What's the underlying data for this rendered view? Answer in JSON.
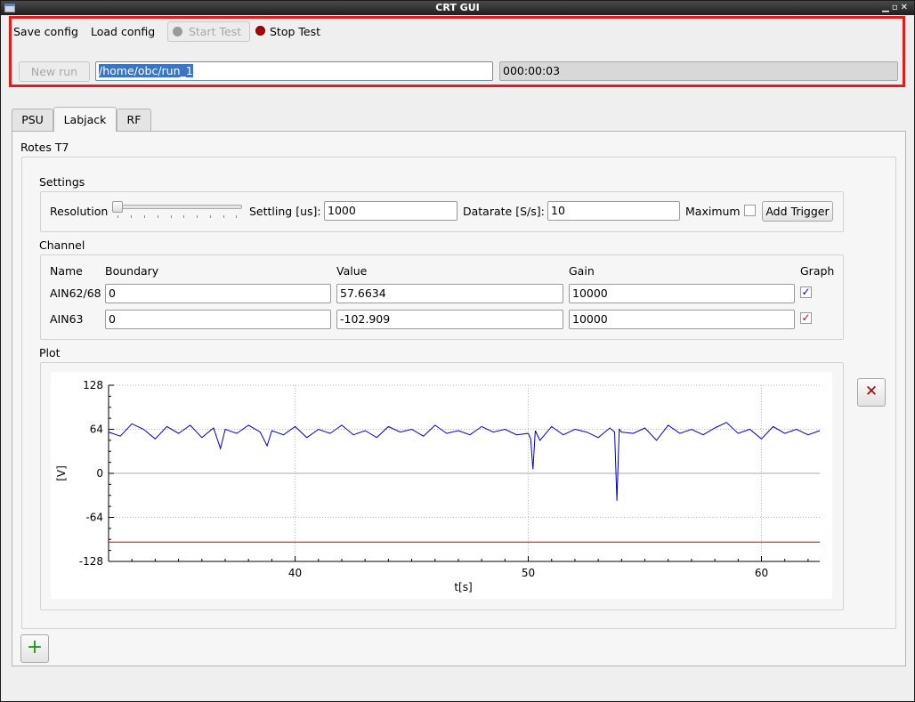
{
  "window": {
    "title": "CRT GUI"
  },
  "toolbar": {
    "save_config": "Save config",
    "load_config": "Load config",
    "start_test": "Start Test",
    "stop_test": "Stop Test",
    "new_run": "New run",
    "run_path": "/home/obc/run_1",
    "elapsed": "000:00:03"
  },
  "tabs": [
    {
      "label": "PSU"
    },
    {
      "label": "Labjack"
    },
    {
      "label": "RF"
    }
  ],
  "device": {
    "name": "Rotes T7"
  },
  "settings": {
    "title": "Settings",
    "resolution_label": "Resolution",
    "settling_label": "Settling [us]:",
    "settling_value": "1000",
    "datarate_label": "Datarate [S/s]:",
    "datarate_value": "10",
    "maximum_label": "Maximum",
    "add_trigger": "Add Trigger"
  },
  "channel": {
    "title": "Channel",
    "headers": {
      "name": "Name",
      "boundary": "Boundary",
      "value": "Value",
      "gain": "Gain",
      "graph": "Graph"
    },
    "rows": [
      {
        "name": "AIN62/68",
        "boundary": "0",
        "value": "57.6634",
        "gain": "10000",
        "graph": true,
        "color": "#0000cc"
      },
      {
        "name": "AIN63",
        "boundary": "0",
        "value": "-102.909",
        "gain": "10000",
        "graph": true,
        "color": "#cc0000"
      }
    ]
  },
  "plot": {
    "title": "Plot"
  },
  "icons": {
    "close": "close-icon",
    "add": "plus-icon"
  },
  "chart_data": {
    "type": "line",
    "xlabel": "t[s]",
    "ylabel": "[V]",
    "xlim": [
      32.0,
      62.5
    ],
    "ylim": [
      -128,
      128
    ],
    "xticks": [
      40,
      50,
      60
    ],
    "yticks": [
      128,
      64,
      0,
      -64,
      -128
    ],
    "grid": true,
    "series": [
      {
        "color": "#0000cc",
        "x": [
          32.0,
          32.5,
          33.0,
          33.5,
          34.0,
          34.5,
          35.0,
          35.5,
          36.0,
          36.5,
          36.8,
          37.0,
          37.5,
          38.0,
          38.5,
          38.8,
          39.0,
          39.5,
          40.0,
          40.5,
          41.0,
          41.5,
          42.0,
          42.5,
          43.0,
          43.5,
          44.0,
          44.5,
          45.0,
          45.5,
          46.0,
          46.5,
          47.0,
          47.5,
          48.0,
          48.5,
          49.0,
          49.5,
          50.0,
          50.1,
          50.2,
          50.3,
          50.5,
          51.0,
          51.5,
          52.0,
          52.5,
          53.0,
          53.5,
          53.7,
          53.8,
          53.9,
          54.0,
          54.5,
          55.0,
          55.5,
          56.0,
          56.5,
          57.0,
          57.5,
          58.0,
          58.5,
          59.0,
          59.5,
          60.0,
          60.5,
          61.0,
          61.5,
          62.0,
          62.5
        ],
        "y": [
          60,
          54,
          72,
          64,
          50,
          68,
          58,
          70,
          52,
          66,
          36,
          64,
          58,
          70,
          60,
          40,
          62,
          56,
          68,
          52,
          64,
          58,
          70,
          56,
          62,
          52,
          68,
          60,
          64,
          54,
          70,
          58,
          62,
          56,
          68,
          60,
          64,
          56,
          58,
          50,
          6,
          62,
          48,
          68,
          56,
          64,
          60,
          52,
          66,
          60,
          -40,
          64,
          60,
          58,
          66,
          48,
          70,
          58,
          64,
          56,
          66,
          74,
          58,
          64,
          50,
          68,
          58,
          64,
          56,
          62
        ]
      },
      {
        "color": "#cc0000",
        "x": [
          32.0,
          62.5
        ],
        "y": [
          -100,
          -100
        ]
      }
    ]
  }
}
